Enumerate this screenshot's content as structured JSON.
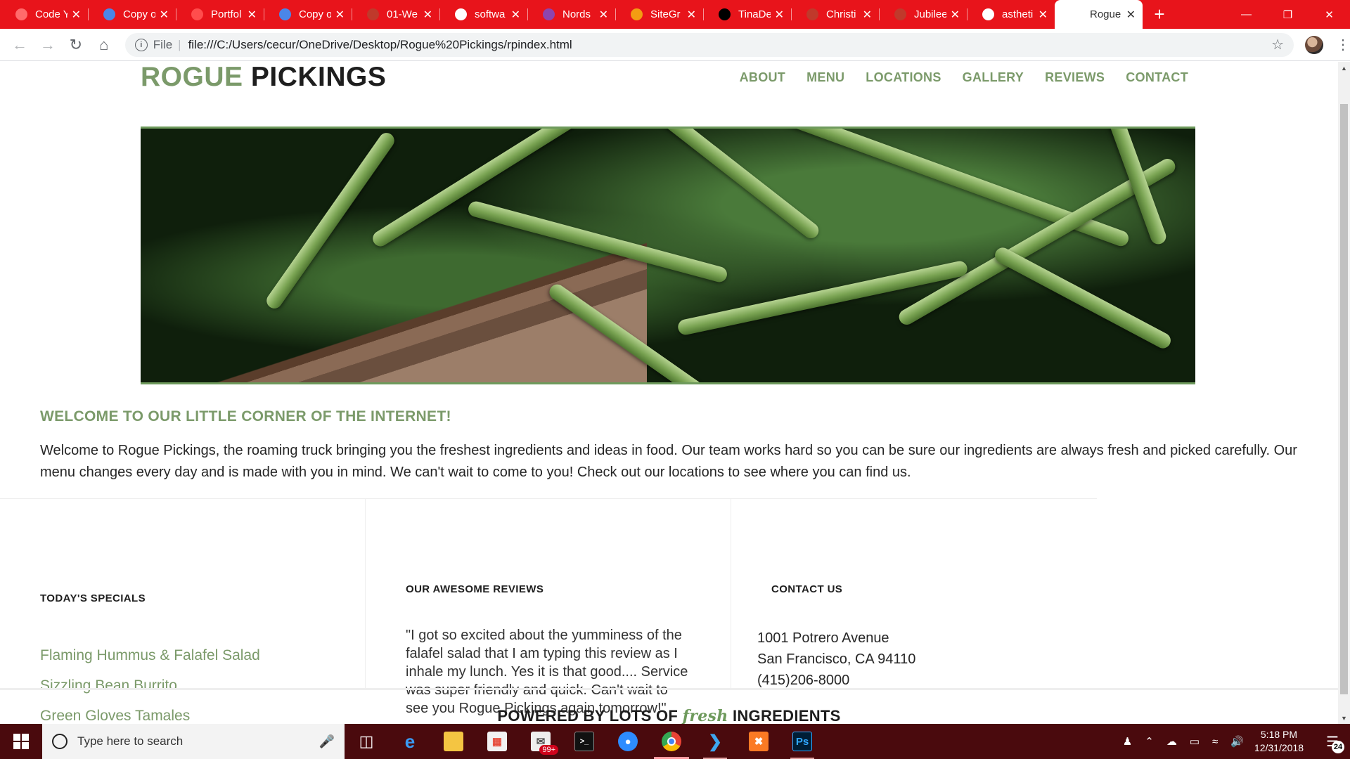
{
  "browser": {
    "tabs": [
      {
        "title": "Code Y",
        "favicon_color": "#ff6b6b"
      },
      {
        "title": "Copy o",
        "favicon_color": "#4a86e8"
      },
      {
        "title": "Portfol",
        "favicon_color": "#ff4d4d"
      },
      {
        "title": "Copy o",
        "favicon_color": "#4a86e8"
      },
      {
        "title": "01-We",
        "favicon_color": "#c0392b"
      },
      {
        "title": "softwa",
        "favicon_color": "#ffffff"
      },
      {
        "title": "Nords",
        "favicon_color": "#8e44ad"
      },
      {
        "title": "SiteGr",
        "favicon_color": "#f39c12"
      },
      {
        "title": "TinaDe",
        "favicon_color": "#000000"
      },
      {
        "title": "Christi",
        "favicon_color": "#c0392b"
      },
      {
        "title": "Jubilee",
        "favicon_color": "#c0392b"
      },
      {
        "title": "astheti",
        "favicon_color": "#ffffff"
      },
      {
        "title": "Rogue",
        "favicon_color": "#ffffff"
      }
    ],
    "tab_close_glyph": "✕",
    "new_tab_glyph": "+",
    "scheme_label": "File",
    "url": "file:///C:/Users/cecur/OneDrive/Desktop/Rogue%20Pickings/rpindex.html",
    "accent_color": "#e8141b"
  },
  "site": {
    "logo_part1": "ROGUE",
    "logo_part2": "PICKINGS",
    "nav": [
      "ABOUT",
      "MENU",
      "LOCATIONS",
      "GALLERY",
      "REVIEWS",
      "CONTACT"
    ],
    "brand_green": "#7b9a6a",
    "welcome_heading": "WELCOME TO OUR LITTLE CORNER OF THE INTERNET!",
    "welcome_text": "Welcome to Rogue Pickings, the roaming truck bringing you the freshest ingredients and ideas in food. Our team works hard so you can be sure our ingredients are always fresh and picked carefully. Our menu changes every day and is made with you in mind. We can't wait to come to you! Check out our locations to see where you can find us.",
    "specials_heading": "TODAY'S SPECIALS",
    "specials": [
      "Flaming Hummus & Falafel Salad",
      "Sizzling Bean Burrito",
      "Green Gloves Tamales"
    ],
    "reviews_heading": "OUR AWESOME REVIEWS",
    "review_text": "\"I got so excited about the yumminess of the falafel salad that I am typing this review as I inhale my lunch. Yes it is that good.... Service was super friendly and quick. Can't wait to see you Rogue Pickings again tomorrow!\"",
    "contact_heading": "CONTACT US",
    "contact_address1": "1001 Potrero Avenue",
    "contact_address2": "San Francisco, CA 94110",
    "contact_phone": "(415)206-8000",
    "footer_part1": "POWERED BY LOTS OF",
    "footer_fresh": "fresh",
    "footer_part2": "INGREDIENTS"
  },
  "taskbar": {
    "search_placeholder": "Type here to search",
    "mail_badge": "99+",
    "time": "5:18 PM",
    "date": "12/31/2018",
    "notification_count": "24"
  }
}
